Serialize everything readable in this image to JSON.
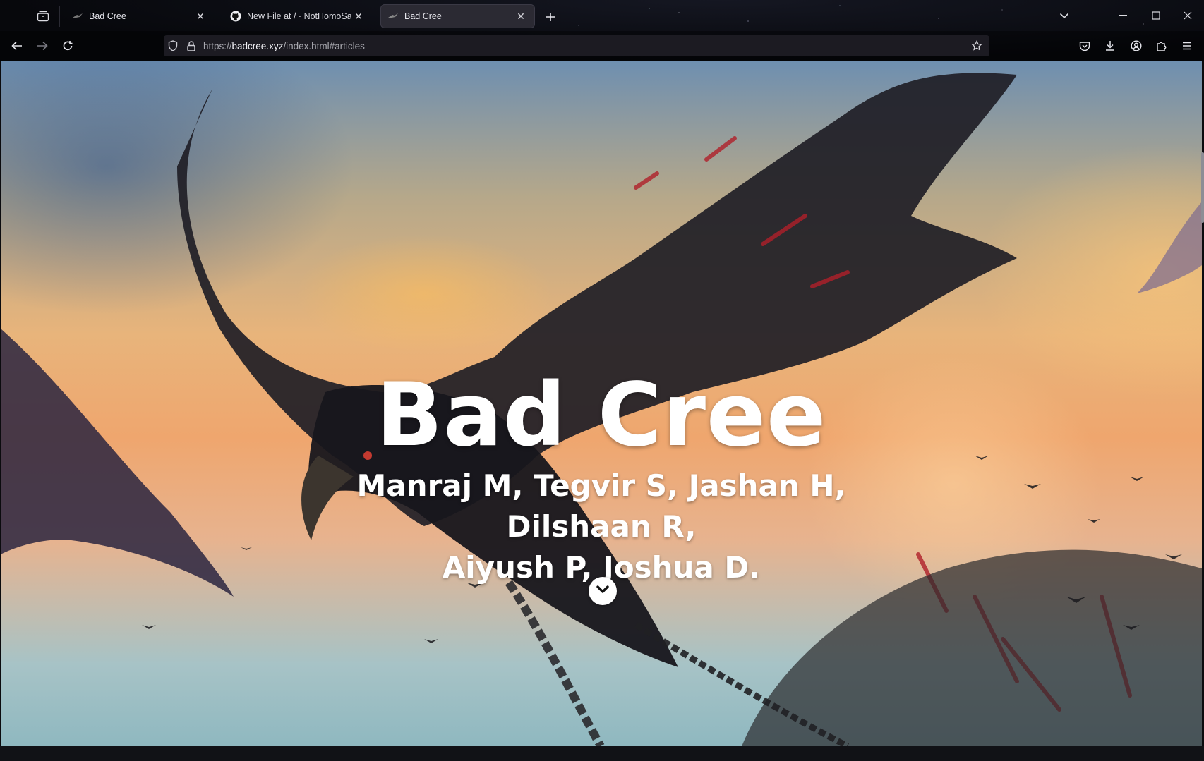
{
  "browser": {
    "tabs": [
      {
        "title": "Bad Cree",
        "active": false
      },
      {
        "title": "New File at / · NotHomoSapien",
        "active": false
      },
      {
        "title": "Bad Cree",
        "active": true
      }
    ],
    "url": {
      "prefix": "https://",
      "domain": "badcree.xyz",
      "path": "/index.html#articles"
    }
  },
  "hero": {
    "title": "Bad Cree",
    "subtitle_line1": "Manraj M, Tegvir S, Jashan H, Dilshaan R,",
    "subtitle_line2": "Aiyush P, Joshua D."
  },
  "colors": {
    "chrome_bg": "#07080c",
    "urlbar_bg": "#1c1b22",
    "active_tab_bg": "#2b2a33",
    "hero_text": "#ffffff"
  }
}
